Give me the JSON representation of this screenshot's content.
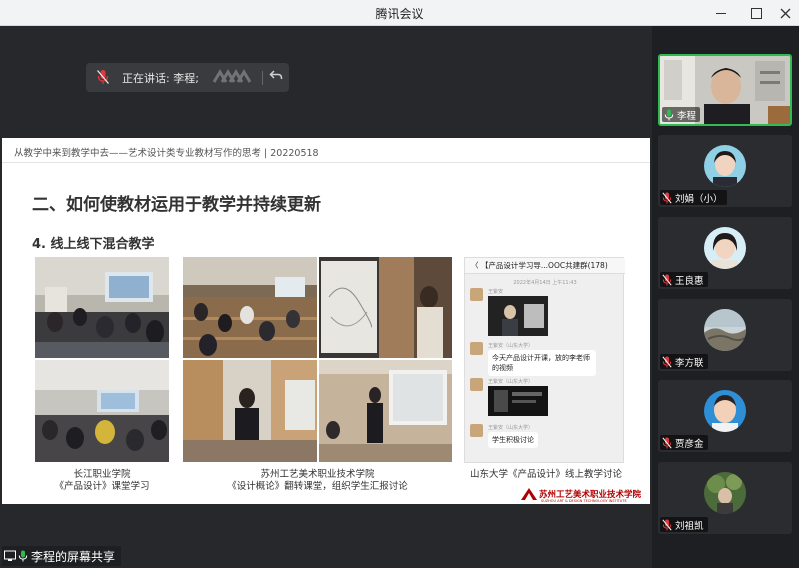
{
  "window": {
    "title": "腾讯会议"
  },
  "speaking": {
    "label": "正在讲话: 李程;"
  },
  "slide": {
    "subtitle": "从教学中来到教学中去——艺术设计类专业教材写作的思考 | 20220518",
    "heading": "二、如何使教材运用于教学并持续更新",
    "subheading": "4. 线上线下混合教学",
    "captions": [
      {
        "line1": "长江职业学院",
        "line2": "《产品设计》课堂学习"
      },
      {
        "line1": "苏州工艺美术职业技术学院",
        "line2": "《设计概论》翻转课堂，组织学生汇报讨论"
      },
      {
        "line1": "山东大学《产品设计》线上教学讨论",
        "line2": ""
      }
    ],
    "chat": {
      "header": "〈   【产品设计学习导...OOC共建群(178)",
      "timestamp": "2022年4月14日 上午11:43",
      "sender1": "王紫安",
      "sender2": "王紫安（山东大学）",
      "bubble1": "今天产品设计开课，放的李老师的视频",
      "bubble2": "学生积极讨论"
    },
    "logo": {
      "name": "苏州工艺美术职业技术学院",
      "english": "SUZHOU ART & DESIGN TECHNOLOGY INSTITUTE"
    }
  },
  "share_label": "李程的屏幕共享",
  "participants": [
    {
      "name": "李程",
      "active": true,
      "muted": false
    },
    {
      "name": "刘娟（小）",
      "active": false,
      "muted": true
    },
    {
      "name": "王良惠",
      "active": false,
      "muted": true
    },
    {
      "name": "李方联",
      "active": false,
      "muted": true
    },
    {
      "name": "贾彦金",
      "active": false,
      "muted": true
    },
    {
      "name": "刘祖凯",
      "active": false,
      "muted": true
    }
  ],
  "colors": {
    "active_border": "#2fbb4f",
    "muted_icon": "#e0393e",
    "logo_red": "#b00000"
  }
}
